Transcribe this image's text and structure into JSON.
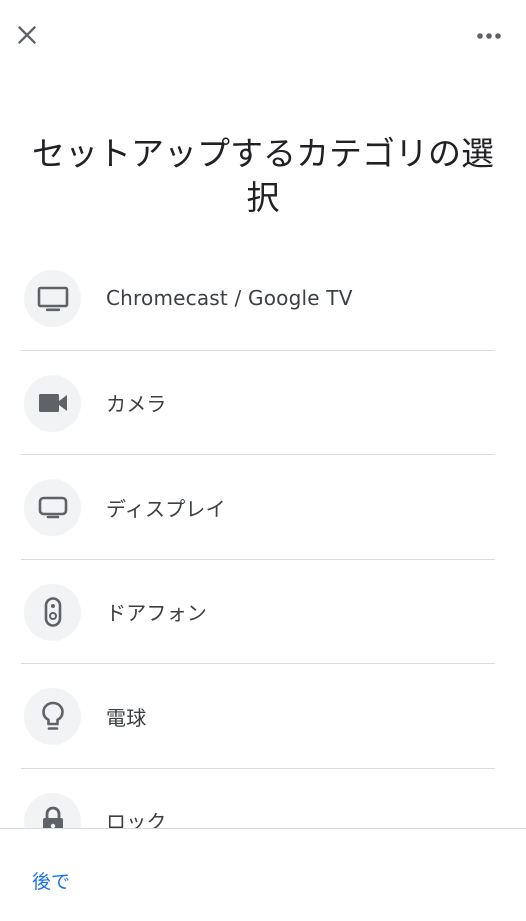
{
  "header": {
    "close_icon": "close-icon",
    "more_icon": "more-horizontal-icon"
  },
  "title": "セットアップするカテゴリの選択",
  "categories": [
    {
      "label": "Chromecast / Google TV",
      "icon": "tv-icon"
    },
    {
      "label": "カメラ",
      "icon": "videocam-icon"
    },
    {
      "label": "ディスプレイ",
      "icon": "display-icon"
    },
    {
      "label": "ドアフォン",
      "icon": "doorbell-icon"
    },
    {
      "label": "電球",
      "icon": "lightbulb-icon"
    },
    {
      "label": "ロック",
      "icon": "lock-icon"
    }
  ],
  "footer": {
    "later_label": "後で"
  },
  "colors": {
    "accent": "#1a73e8",
    "icon": "#5f6368",
    "icon_bg": "#f1f3f4",
    "divider": "#dadce0"
  }
}
